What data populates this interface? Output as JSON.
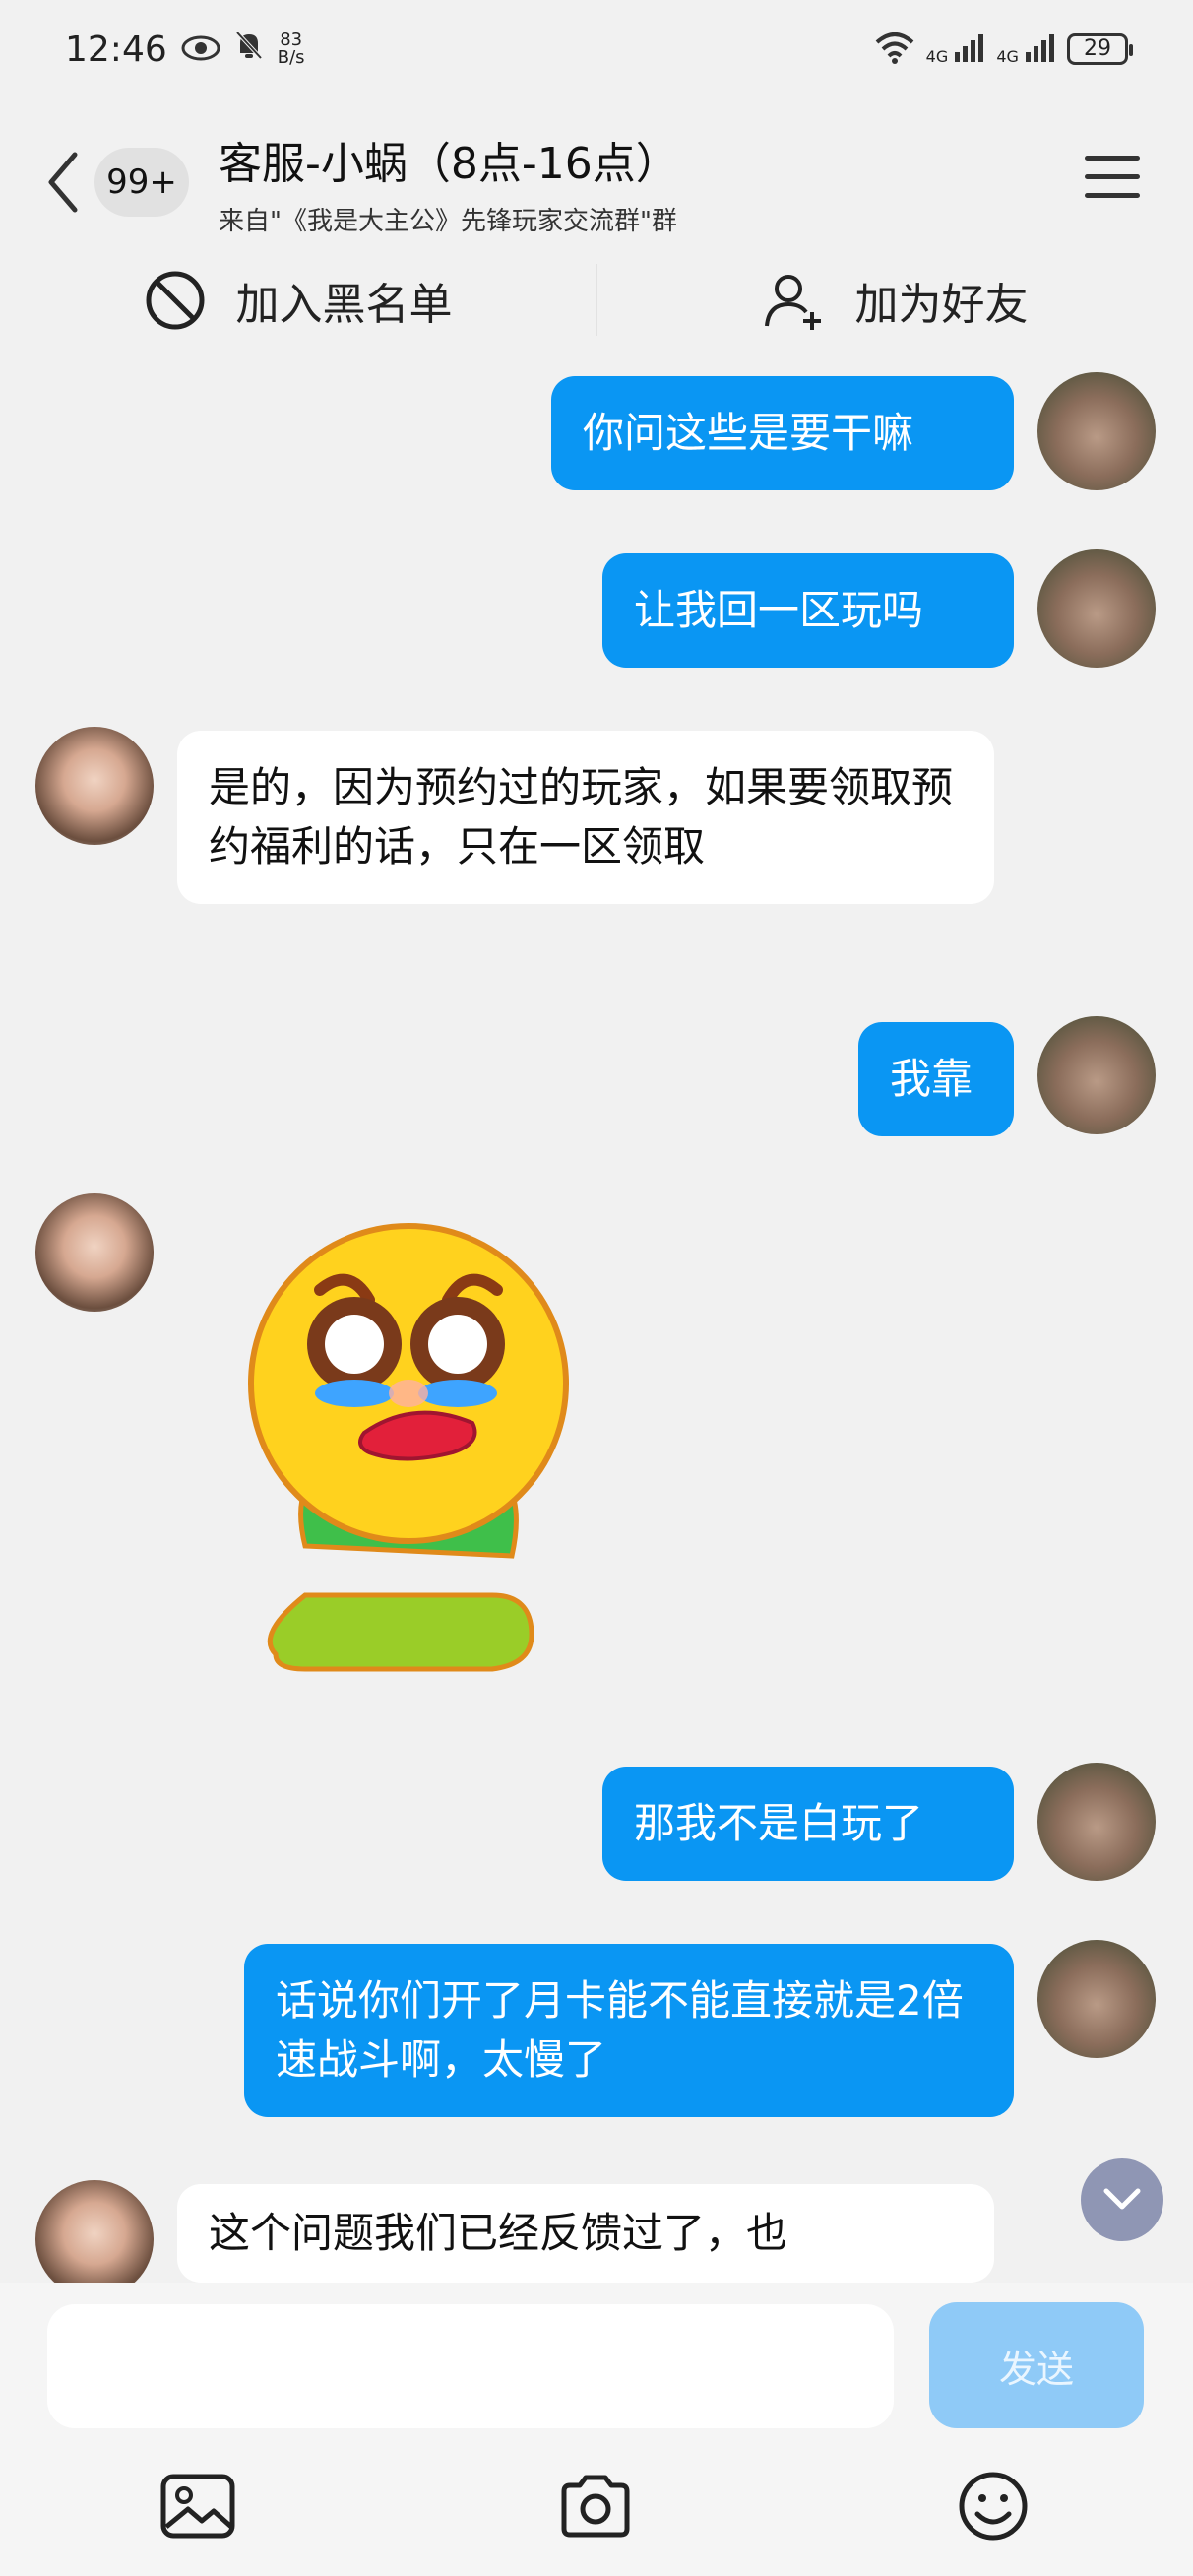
{
  "status_bar": {
    "time": "12:46",
    "net_speed_value": "83",
    "net_speed_unit": "B/s",
    "signal_1": "4G",
    "signal_2": "4G",
    "battery": "29"
  },
  "header": {
    "badge": "99+",
    "title": "客服-小蜗（8点-16点）",
    "subtitle": "来自\"《我是大主公》先锋玩家交流群\"群"
  },
  "actions": {
    "blacklist": "加入黑名单",
    "add_friend": "加为好友"
  },
  "messages": [
    {
      "side": "me",
      "text": "你问这些是要干嘛"
    },
    {
      "side": "me",
      "text": "让我回一区玩吗"
    },
    {
      "side": "them",
      "text": "是的，因为预约过的玩家，如果要领取预约福利的话，只在一区领取"
    },
    {
      "side": "me",
      "text": "我靠"
    },
    {
      "side": "them",
      "sticker": "crying-kneeling-emoji"
    },
    {
      "side": "me",
      "text": "那我不是白玩了"
    },
    {
      "side": "me",
      "text": "话说你们开了月卡能不能直接就是2倍速战斗啊，太慢了"
    },
    {
      "side": "them",
      "text": "这个问题我们已经反馈过了，也"
    }
  ],
  "input": {
    "placeholder": "",
    "send_label": "发送"
  },
  "colors": {
    "my_bubble": "#0a96f3",
    "their_bubble": "#ffffff",
    "send_disabled": "#8fcaf7",
    "background": "#f1f1f1"
  }
}
